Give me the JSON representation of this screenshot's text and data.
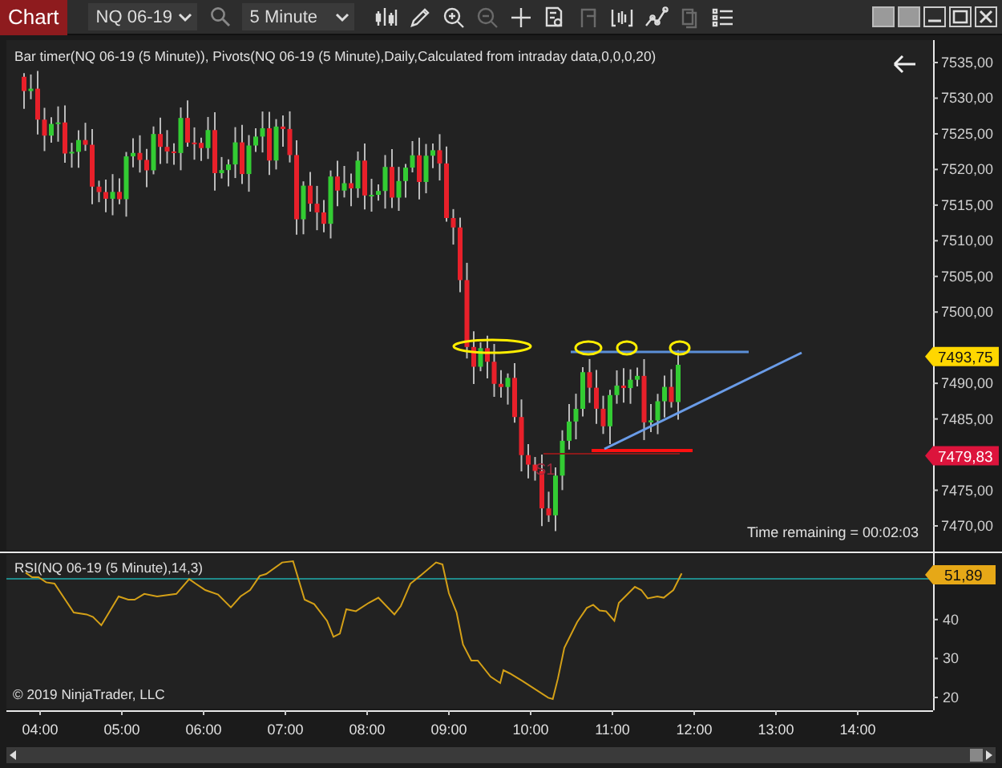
{
  "toolbar": {
    "title_button": "Chart",
    "instrument": {
      "value": "NQ 06-19"
    },
    "timeframe": {
      "value": "5 Minute"
    },
    "tools": [
      {
        "kind": "bars",
        "disabled": false
      },
      {
        "kind": "pencil",
        "disabled": false
      },
      {
        "kind": "zoom-in",
        "disabled": false
      },
      {
        "kind": "zoom-out",
        "disabled": true
      },
      {
        "kind": "crosshair",
        "disabled": false
      },
      {
        "kind": "data-box",
        "disabled": false
      },
      {
        "kind": "flag",
        "disabled": true
      },
      {
        "kind": "properties",
        "disabled": false
      },
      {
        "kind": "drawing",
        "disabled": false
      },
      {
        "kind": "copy",
        "disabled": true
      },
      {
        "kind": "list",
        "disabled": false
      }
    ]
  },
  "price_panel": {
    "indicator_label": "Bar timer(NQ 06-19 (5 Minute)), Pivots(NQ 06-19 (5 Minute),Daily,Calculated from intraday data,0,0,0,20)",
    "price_ticks": [
      "7535,00",
      "7530,00",
      "7525,00",
      "7520,00",
      "7515,00",
      "7510,00",
      "7505,00",
      "7500,00",
      "7490,00",
      "7485,00",
      "7475,00",
      "7470,00"
    ],
    "price_markers": [
      {
        "text": "7493,75",
        "color": "#ffd700"
      },
      {
        "text": "7479,83",
        "color": "#dc143c"
      }
    ],
    "pivot_label": "S1",
    "time_remaining": "Time remaining = 00:02:03"
  },
  "rsi_panel": {
    "label": "RSI(NQ 06-19 (5 Minute),14,3)",
    "ticks": [
      "40",
      "30",
      "20"
    ],
    "marker": {
      "text": "51,89",
      "color": "#e6a817"
    },
    "copyright": "© 2019 NinjaTrader, LLC"
  },
  "time_axis": [
    "04:00",
    "05:00",
    "06:00",
    "07:00",
    "08:00",
    "09:00",
    "10:00",
    "11:00",
    "12:00",
    "13:00",
    "14:00"
  ]
}
